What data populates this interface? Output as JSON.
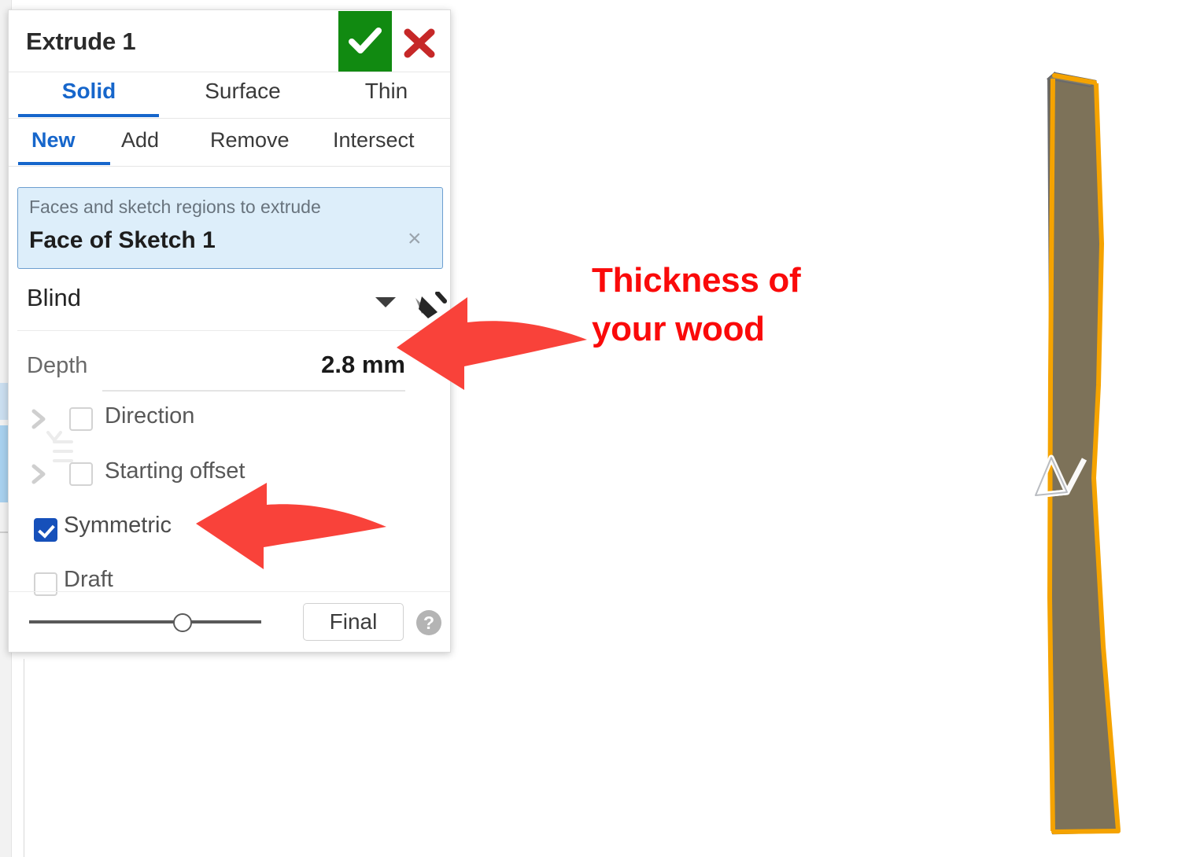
{
  "panel": {
    "title": "Extrude 1",
    "accept_icon": "check-icon",
    "cancel_icon": "close-icon",
    "accept_color": "#118a11",
    "cancel_color": "#c62828",
    "accent_color": "#1666cb",
    "tabs_primary": [
      {
        "label": "Solid",
        "active": true
      },
      {
        "label": "Surface",
        "active": false
      },
      {
        "label": "Thin",
        "active": false
      }
    ],
    "tabs_secondary": [
      {
        "label": "New",
        "active": true
      },
      {
        "label": "Add",
        "active": false
      },
      {
        "label": "Remove",
        "active": false
      },
      {
        "label": "Intersect",
        "active": false
      }
    ],
    "selection": {
      "placeholder": "Faces and sketch regions to extrude",
      "value": "Face of Sketch 1",
      "clear_icon": "×"
    },
    "end_condition": {
      "value": "Blind",
      "caret_icon": "chevron-down-icon",
      "flip_icon": "flip-direction-icon"
    },
    "depth": {
      "label": "Depth",
      "value": "2.8 mm"
    },
    "options": [
      {
        "label": "Direction",
        "checked": false,
        "expandable": true
      },
      {
        "label": "Starting offset",
        "checked": false,
        "expandable": true
      },
      {
        "label": "Symmetric",
        "checked": true,
        "expandable": false
      },
      {
        "label": "Draft",
        "checked": false,
        "expandable": false
      }
    ],
    "footer": {
      "slider_position_percent": 62,
      "final_label": "Final",
      "help_icon": "?"
    }
  },
  "annotations": [
    {
      "text_line1": "Thickness of",
      "text_line2": "your wood",
      "color": "#fa0a0a",
      "arrow": "left-curved-arrow"
    },
    {
      "arrow": "left-curved-arrow",
      "color": "#f9423a"
    }
  ],
  "viewport": {
    "model_name": "extruded-wood-board",
    "body_color": "#7d7259",
    "highlight_edge_color": "#f5a300",
    "outline_color": "#6a6a6a",
    "origin_marker": "sketch-plane-triangle-icon",
    "background": "#ffffff"
  }
}
